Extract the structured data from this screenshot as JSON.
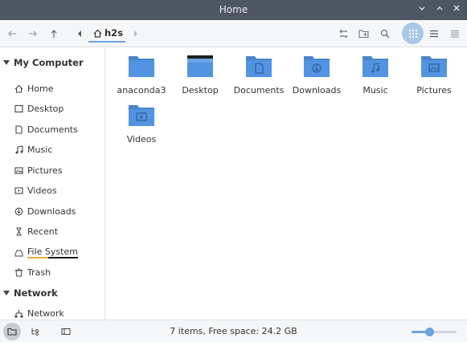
{
  "window": {
    "title": "Home"
  },
  "toolbar": {
    "breadcrumb": {
      "label": "h2s"
    }
  },
  "sidebar": {
    "sections": [
      {
        "title": "My Computer",
        "items": [
          {
            "label": "Home",
            "icon": "home-icon"
          },
          {
            "label": "Desktop",
            "icon": "desktop-icon"
          },
          {
            "label": "Documents",
            "icon": "document-icon"
          },
          {
            "label": "Music",
            "icon": "music-icon"
          },
          {
            "label": "Pictures",
            "icon": "picture-icon"
          },
          {
            "label": "Videos",
            "icon": "video-icon"
          },
          {
            "label": "Downloads",
            "icon": "download-icon"
          },
          {
            "label": "Recent",
            "icon": "recent-icon"
          },
          {
            "label": "File System",
            "icon": "drive-icon"
          },
          {
            "label": "Trash",
            "icon": "trash-icon"
          }
        ]
      },
      {
        "title": "Network",
        "items": [
          {
            "label": "Network",
            "icon": "network-icon"
          }
        ]
      }
    ]
  },
  "files": [
    {
      "name": "anaconda3",
      "icon": "folder-icon"
    },
    {
      "name": "Desktop",
      "icon": "desktop-folder-icon"
    },
    {
      "name": "Documents",
      "icon": "documents-folder-icon"
    },
    {
      "name": "Downloads",
      "icon": "downloads-folder-icon"
    },
    {
      "name": "Music",
      "icon": "music-folder-icon"
    },
    {
      "name": "Pictures",
      "icon": "pictures-folder-icon"
    },
    {
      "name": "Videos",
      "icon": "videos-folder-icon"
    }
  ],
  "statusbar": {
    "text": "7 items, Free space: 24.2 GB",
    "zoom_level": 0.4
  },
  "colors": {
    "titlebar": "#4e5663",
    "folder": "#5294e2",
    "accent": "#6aa5d8"
  }
}
